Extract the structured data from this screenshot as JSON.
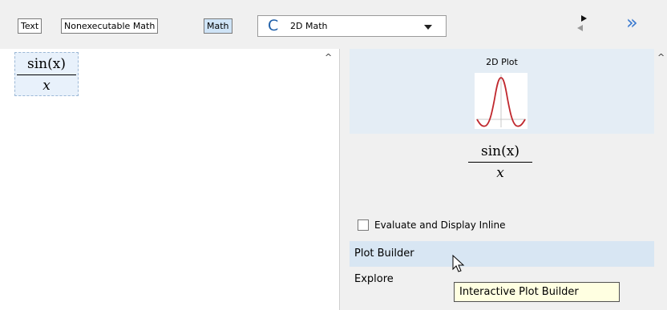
{
  "toolbar": {
    "mode_buttons": [
      "Text",
      "Nonexecutable Math",
      "Math"
    ],
    "active_mode": "Math",
    "input_style": {
      "value": "2D Math",
      "icon": "C"
    },
    "nav": {
      "forward_icon": "triangle-right-icon",
      "back_icon": "triangle-left-icon"
    },
    "expand_icon": "double-chevron-right-icon"
  },
  "editor": {
    "expression": {
      "numerator": "sin(x)",
      "denominator": "x"
    }
  },
  "context_panel": {
    "preview": {
      "title": "2D Plot"
    },
    "expression": {
      "numerator": "sin(x)",
      "denominator": "x"
    },
    "checkbox": {
      "label": "Evaluate and Display Inline",
      "checked": false
    },
    "menu_items": [
      "Plot Builder",
      "Explore"
    ],
    "hovered_item": "Plot Builder"
  },
  "tooltip": {
    "text": "Interactive Plot Builder"
  },
  "colors": {
    "accent": "#3b7ad0",
    "plot_curve": "#c0282e",
    "hover": "#d8e6f3",
    "tooltip_bg": "#ffffe1"
  }
}
